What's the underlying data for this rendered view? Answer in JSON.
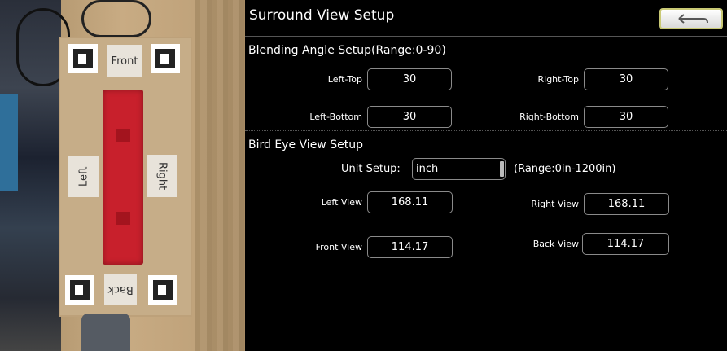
{
  "camera": {
    "labels": {
      "front": "Front",
      "left": "Left",
      "right": "Right",
      "back": "Back"
    }
  },
  "header": {
    "title": "Surround View Setup",
    "back_icon": "back-arrow-icon"
  },
  "blending": {
    "heading": "Blending Angle Setup(Range:0-90)",
    "left_top_label": "Left-Top",
    "left_top_value": "30",
    "right_top_label": "Right-Top",
    "right_top_value": "30",
    "left_bottom_label": "Left-Bottom",
    "left_bottom_value": "30",
    "right_bottom_label": "Right-Bottom",
    "right_bottom_value": "30"
  },
  "bird_eye": {
    "heading": "Bird Eye View Setup",
    "unit_label": "Unit Setup:",
    "unit_value": "inch",
    "range": "(Range:0in-1200in)",
    "left_view_label": "Left View",
    "left_view_value": "168.11",
    "right_view_label": "Right View",
    "right_view_value": "168.11",
    "front_view_label": "Front View",
    "front_view_value": "114.17",
    "back_view_label": "Back View",
    "back_view_value": "114.17"
  }
}
